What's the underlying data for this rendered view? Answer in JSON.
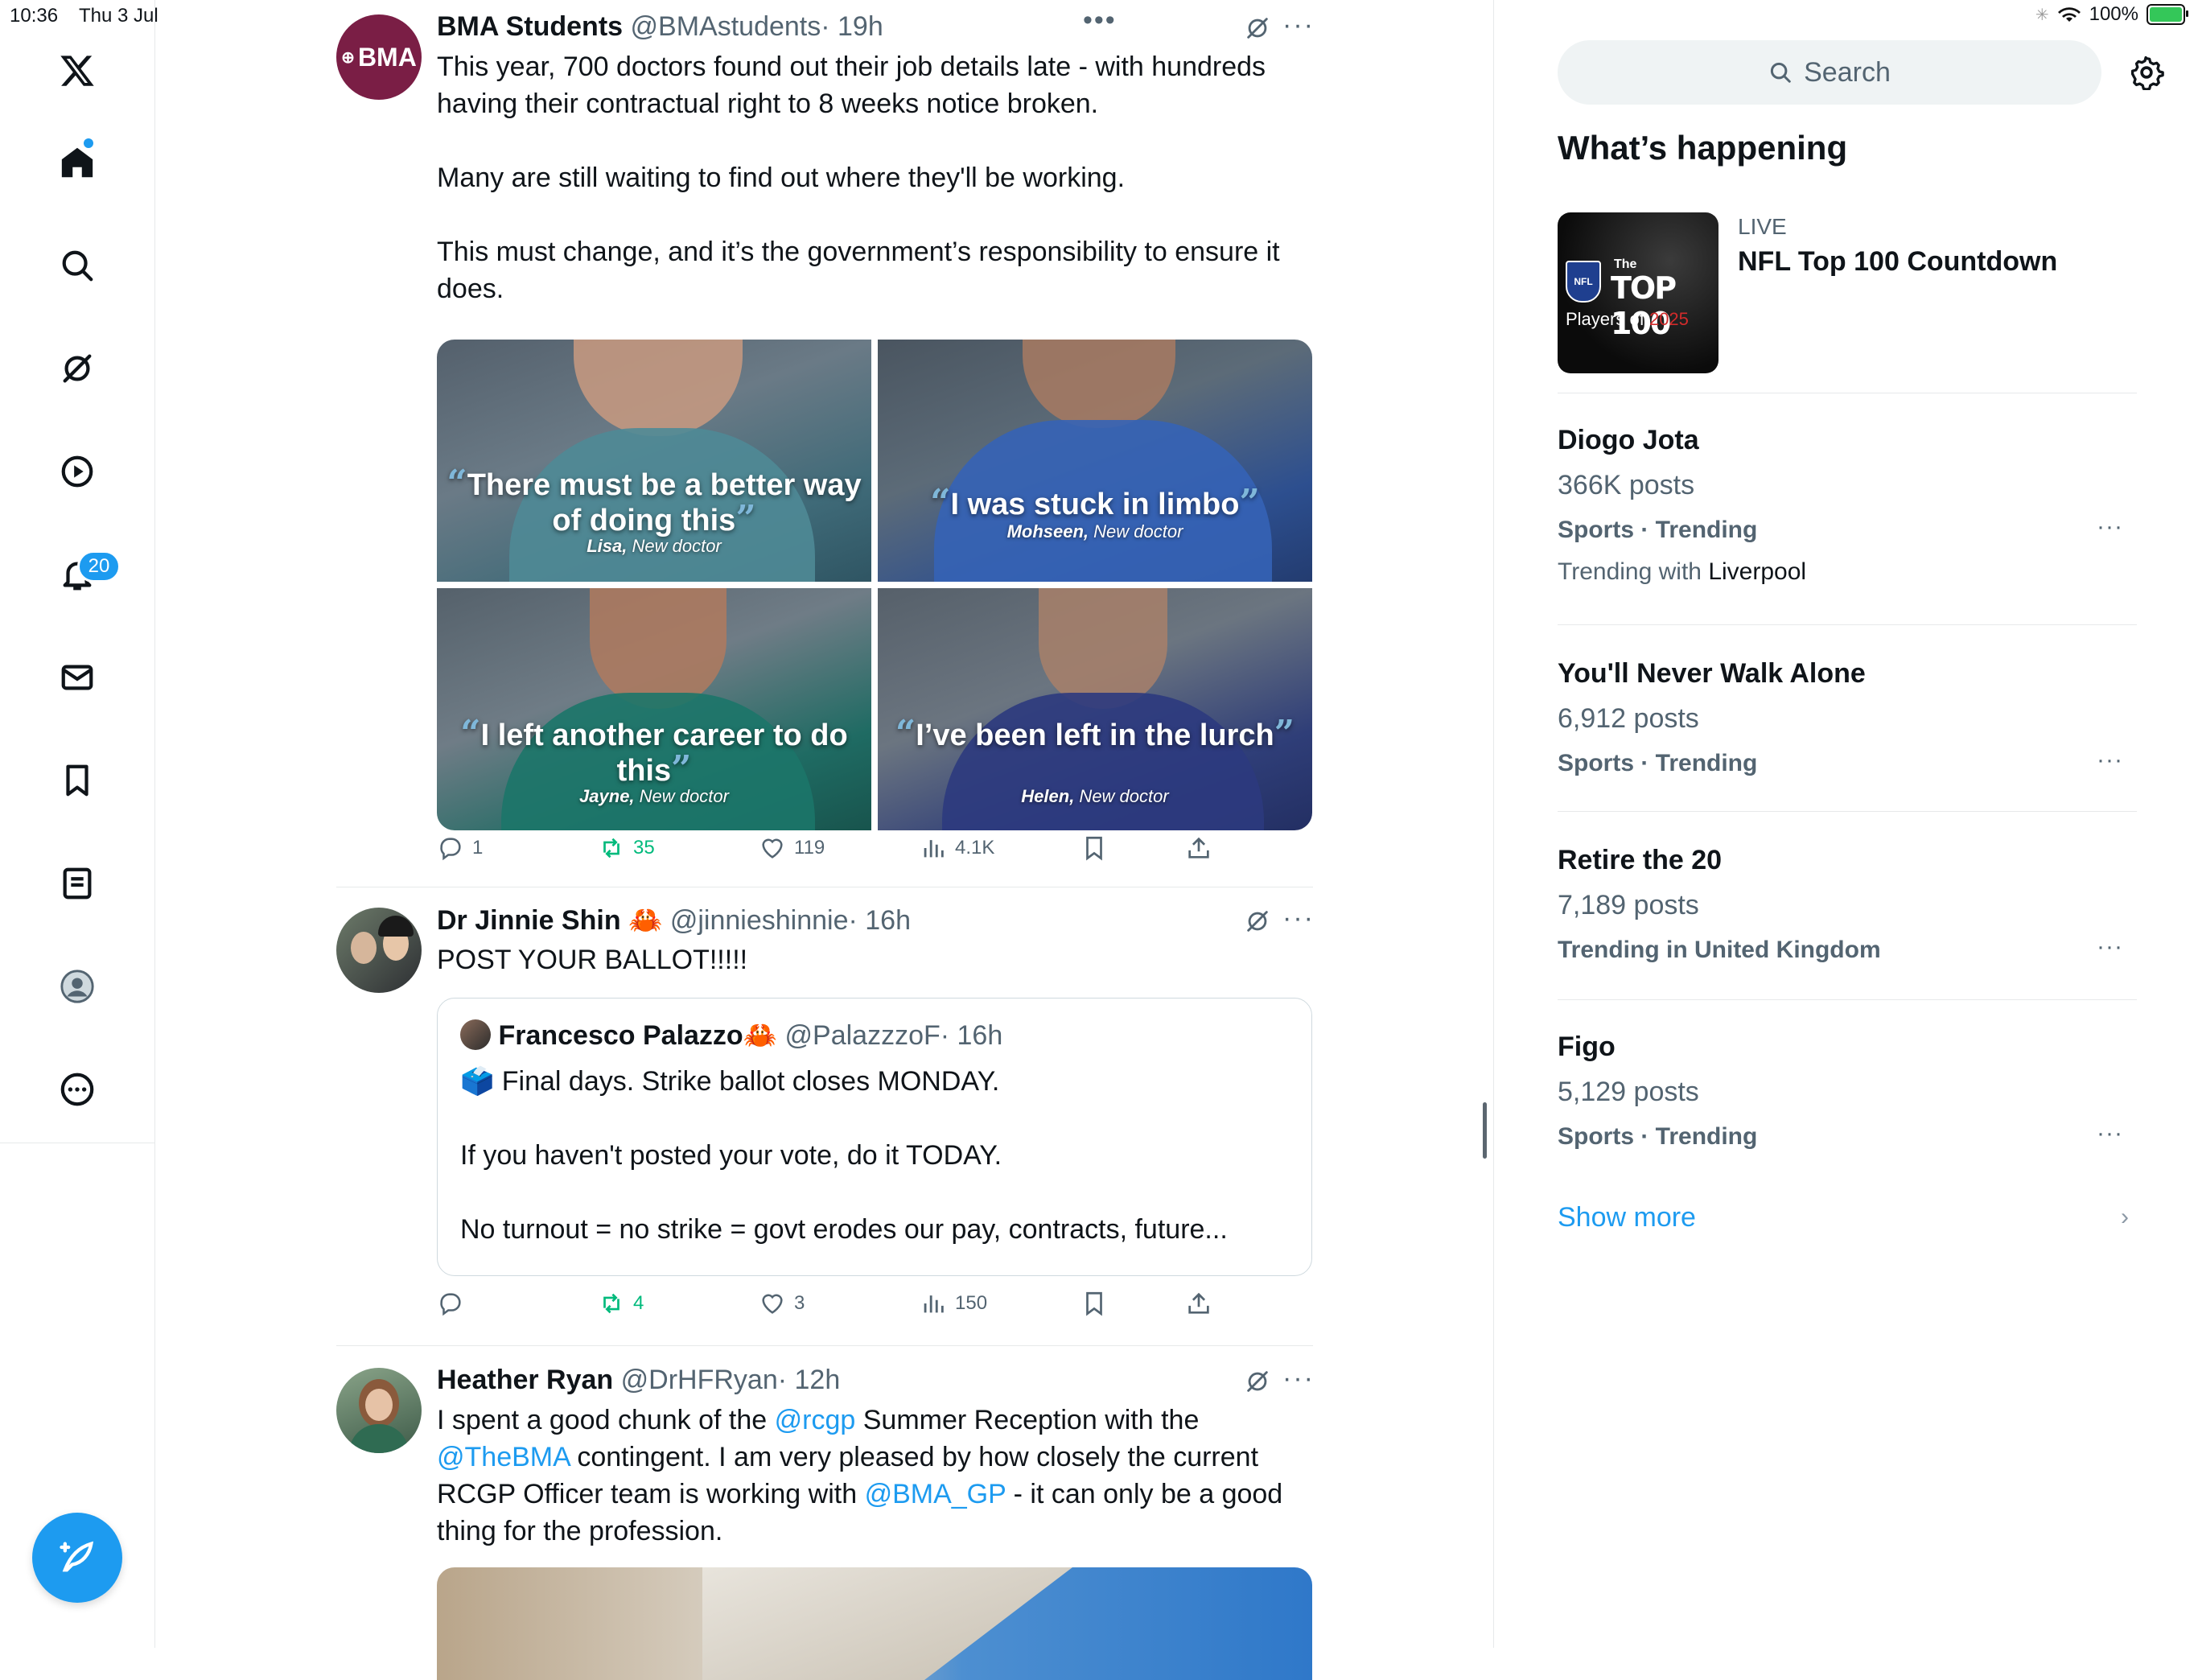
{
  "status": {
    "time": "10:36",
    "date": "Thu 3 Jul",
    "battery": "100%"
  },
  "nav": {
    "notifications_badge": "20"
  },
  "tweets": [
    {
      "name": "BMA Students",
      "handle": "@BMAstudents",
      "time": "· 19h",
      "avatar_text": "BMA",
      "text": "This year, 700 doctors found out their job details late - with hundreds having their contractual right to 8 weeks notice broken.\n\nMany are still waiting to find out where they'll be working.\n\nThis must change, and it’s the government’s responsibility to ensure it does.",
      "media": [
        {
          "quote": "There must be a better way of doing this",
          "name": "Lisa,",
          "role": " New doctor"
        },
        {
          "quote": "I was stuck in limbo",
          "name": "Mohseen,",
          "role": " New doctor"
        },
        {
          "quote": "I left another career to do this",
          "name": "Jayne,",
          "role": " New doctor"
        },
        {
          "quote": "I’ve been left in the lurch",
          "name": "Helen,",
          "role": " New doctor"
        }
      ],
      "actions": {
        "replies": "1",
        "reposts": "35",
        "likes": "119",
        "views": "4.1K"
      }
    },
    {
      "name": "Dr Jinnie Shin",
      "emoji": "🦀",
      "handle": "@jinnieshinnie",
      "time": "· 16h",
      "text": "POST YOUR BALLOT!!!!!",
      "quote": {
        "name": "Francesco Palazzo",
        "emoji": "🦀",
        "handle": "@PalazzzoF",
        "time": "· 16h",
        "text": "🗳️ Final days. Strike ballot closes MONDAY.\n\nIf you haven't posted your vote, do it TODAY.\n\nNo turnout = no strike = govt erodes our pay, contracts, future..."
      },
      "actions": {
        "replies": "",
        "reposts": "4",
        "likes": "3",
        "views": "150"
      }
    },
    {
      "name": "Heather Ryan",
      "handle": "@DrHFRyan",
      "time": "· 12h",
      "text_parts": [
        {
          "t": "I spent a good chunk of the ",
          "m": false
        },
        {
          "t": "@rcgp",
          "m": true
        },
        {
          "t": " Summer Reception with the\n",
          "m": false
        },
        {
          "t": "@TheBMA",
          "m": true
        },
        {
          "t": " contingent. I am very pleased by how closely the current RCGP Officer team is working with ",
          "m": false
        },
        {
          "t": "@BMA_GP",
          "m": true
        },
        {
          "t": " - it can only be a good thing for the profession.",
          "m": false
        }
      ]
    }
  ],
  "right": {
    "search_placeholder": "Search",
    "title": "What’s happening",
    "live": {
      "label": "LIVE",
      "title": "NFL Top 100 Countdown",
      "thumb_the": "The",
      "thumb_top": "TOP 100",
      "thumb_players": "Players of",
      "thumb_year": "2025",
      "thumb_logo": "NFL"
    },
    "trends": [
      {
        "name": "Diogo Jota",
        "posts": "366K posts",
        "context": "Sports · Trending",
        "with_label": "Trending with ",
        "with": "Liverpool"
      },
      {
        "name": "You'll Never Walk Alone",
        "posts": "6,912 posts",
        "context": "Sports · Trending"
      },
      {
        "name": "Retire the 20",
        "posts": "7,189 posts",
        "context": "Trending in United Kingdom"
      },
      {
        "name": "Figo",
        "posts": "5,129 posts",
        "context": "Sports · Trending"
      }
    ],
    "show_more": "Show more"
  },
  "colors": {
    "accent": "#1d9bf0",
    "repost": "#00ba7c",
    "text": "#0f1419",
    "secondary": "#536471",
    "bma": "#7a1e45"
  }
}
